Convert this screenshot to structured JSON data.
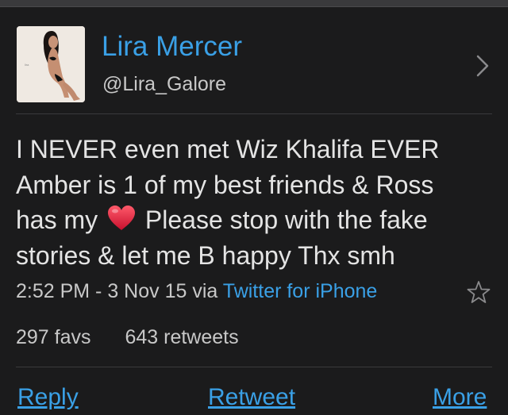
{
  "profile": {
    "name": "Lira Mercer",
    "handle": "@Lira_Galore",
    "avatar_icon": "profile-photo"
  },
  "tweet": {
    "line1": "I NEVER even met Wiz Khalifa EVER",
    "line2": "Amber is 1 of my best friends & Ross",
    "line3_before": "has my",
    "emoji": "red-heart",
    "line3_after": "Please stop with the fake",
    "line4": "stories & let me B happy Thx smh"
  },
  "meta": {
    "time": "2:52 PM - 3 Nov 15 via",
    "source": "Twitter for iPhone"
  },
  "stats": {
    "favs": "297 favs",
    "retweets": "643 retweets"
  },
  "actions": {
    "reply": "Reply",
    "retweet": "Retweet",
    "more": "More"
  },
  "colors": {
    "background": "#1b1b1c",
    "link": "#3aa0e6",
    "text": "#e4e4e4",
    "heart": "#e0233a"
  }
}
